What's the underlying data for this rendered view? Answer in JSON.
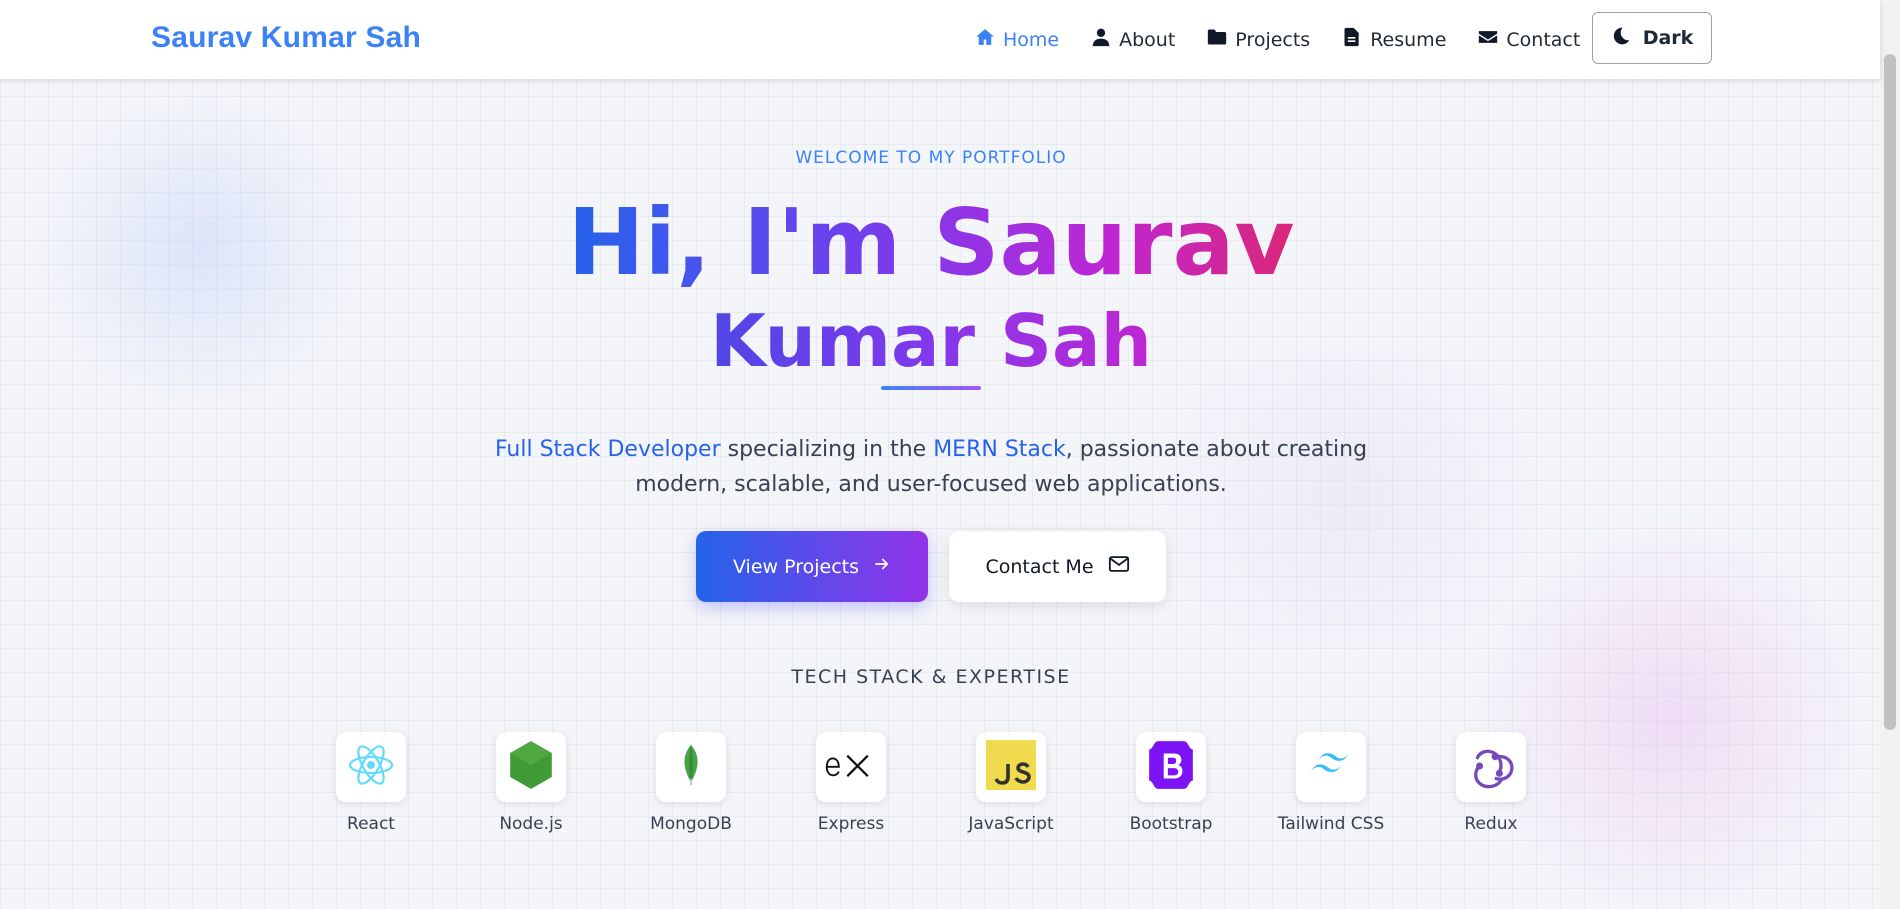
{
  "navbar": {
    "brand": "Saurav Kumar Sah",
    "items": [
      {
        "label": "Home",
        "icon": "home-icon",
        "active": true
      },
      {
        "label": "About",
        "icon": "user-icon",
        "active": false
      },
      {
        "label": "Projects",
        "icon": "folder-icon",
        "active": false
      },
      {
        "label": "Resume",
        "icon": "file-icon",
        "active": false
      },
      {
        "label": "Contact",
        "icon": "envelope-icon",
        "active": false
      }
    ],
    "theme_toggle": {
      "label": "Dark",
      "icon": "moon-icon"
    }
  },
  "hero": {
    "welcome": "WELCOME TO MY PORTFOLIO",
    "headline_line1": "Hi, I'm Saurav",
    "headline_line2": "Kumar Sah",
    "tagline_part1": "Full Stack Developer",
    "tagline_part2": " specializing in the ",
    "tagline_part3": "MERN Stack",
    "tagline_part4": ", passionate about creating",
    "tagline_line2": "modern, scalable, and user-focused web applications.",
    "primary_button": "View Projects",
    "secondary_button": "Contact Me"
  },
  "tech_stack": {
    "title": "TECH STACK & EXPERTISE",
    "items": [
      {
        "label": "React",
        "icon": "react-icon"
      },
      {
        "label": "Node.js",
        "icon": "nodejs-icon"
      },
      {
        "label": "MongoDB",
        "icon": "mongodb-icon"
      },
      {
        "label": "Express",
        "icon": "express-icon"
      },
      {
        "label": "JavaScript",
        "icon": "javascript-icon"
      },
      {
        "label": "Bootstrap",
        "icon": "bootstrap-icon"
      },
      {
        "label": "Tailwind CSS",
        "icon": "tailwind-icon"
      },
      {
        "label": "Redux",
        "icon": "redux-icon"
      }
    ]
  },
  "colors": {
    "accent": "#3b82f6",
    "gradient_start": "#2563eb",
    "gradient_end": "#9333ea"
  }
}
